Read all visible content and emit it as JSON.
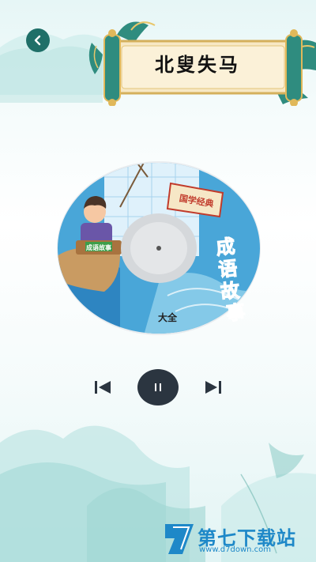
{
  "header": {
    "title": "北叟失马",
    "back_icon": "chevron-left-icon"
  },
  "disc": {
    "banner_text": "国学经典",
    "cover_title": "成语故事",
    "cover_subtitle": "大全",
    "board_text": "成语故事",
    "colors": {
      "sky": "#49a6d8",
      "ring": "#e9ecef",
      "center": "#cfd3d6"
    }
  },
  "player": {
    "prev_icon": "skip-previous-icon",
    "pause_icon": "pause-icon",
    "next_icon": "skip-next-icon",
    "accent": "#2b3540"
  },
  "watermark": {
    "brand": "第七下载站",
    "url": "www.d7down.com"
  }
}
